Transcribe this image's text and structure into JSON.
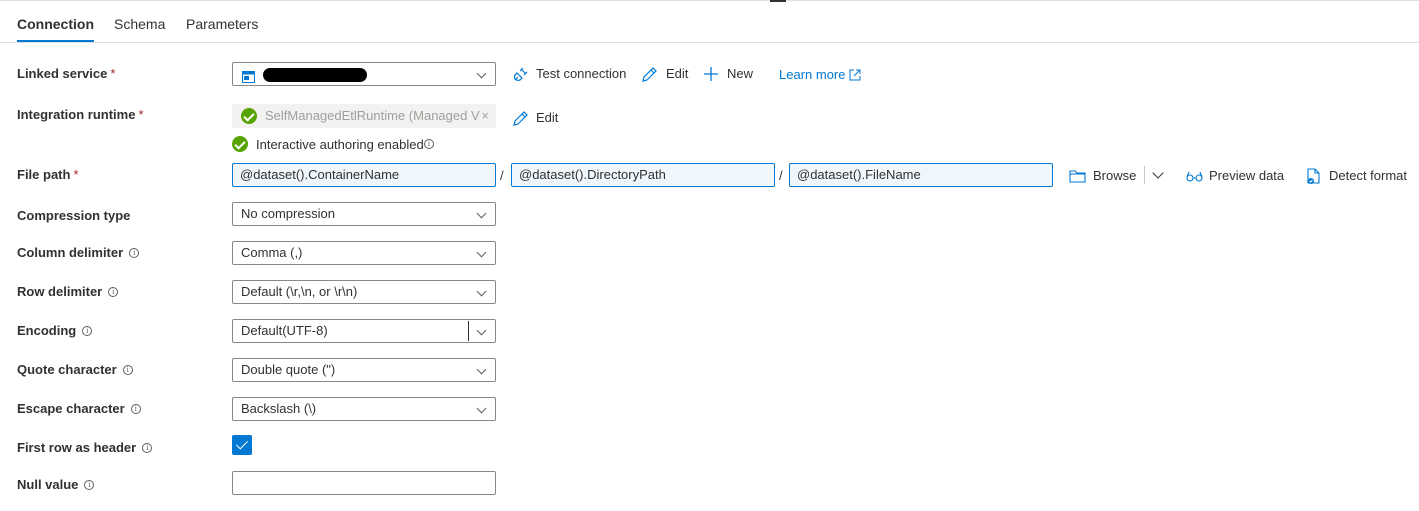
{
  "tabs": [
    "Connection",
    "Schema",
    "Parameters"
  ],
  "linked_service": {
    "label": "Linked service",
    "required_mark": "*",
    "value": "",
    "actions": {
      "test_connection": "Test connection",
      "edit": "Edit",
      "new": "New",
      "learn_more": "Learn more"
    }
  },
  "integration_runtime": {
    "label": "Integration runtime",
    "required_mark": "*",
    "value": "SelfManagedEtlRuntime (Managed V",
    "clear": "×",
    "edit": "Edit",
    "status": "Interactive authoring enabled"
  },
  "file_path": {
    "label": "File path",
    "required_mark": "*",
    "container": "@dataset().ContainerName",
    "directory": "@dataset().DirectoryPath",
    "file": "@dataset().FileName",
    "separator": "/",
    "actions": {
      "browse": "Browse",
      "preview": "Preview data",
      "detect": "Detect format"
    }
  },
  "fields": {
    "compression_type": {
      "label": "Compression type",
      "value": "No compression"
    },
    "column_delimiter": {
      "label": "Column delimiter",
      "value": "Comma (,)"
    },
    "row_delimiter": {
      "label": "Row delimiter",
      "value": "Default (\\r,\\n, or \\r\\n)"
    },
    "encoding": {
      "label": "Encoding",
      "value": "Default(UTF-8)"
    },
    "quote_character": {
      "label": "Quote character",
      "value": "Double quote (\")"
    },
    "escape_character": {
      "label": "Escape character",
      "value": "Backslash (\\)"
    },
    "first_row_header": {
      "label": "First row as header",
      "checked": true
    },
    "null_value": {
      "label": "Null value",
      "value": ""
    }
  },
  "info_glyph": "i",
  "colors": {
    "accent": "#0078d4",
    "success": "#57a300",
    "required": "#a4262c",
    "text": "#323130"
  },
  "icons": [
    "storage-icon",
    "plug-icon",
    "pencil-icon",
    "plus-icon",
    "external-link-icon",
    "check-circle-icon",
    "info-icon",
    "folder-icon",
    "chevron-down-icon",
    "glasses-icon",
    "detect-format-icon"
  ]
}
